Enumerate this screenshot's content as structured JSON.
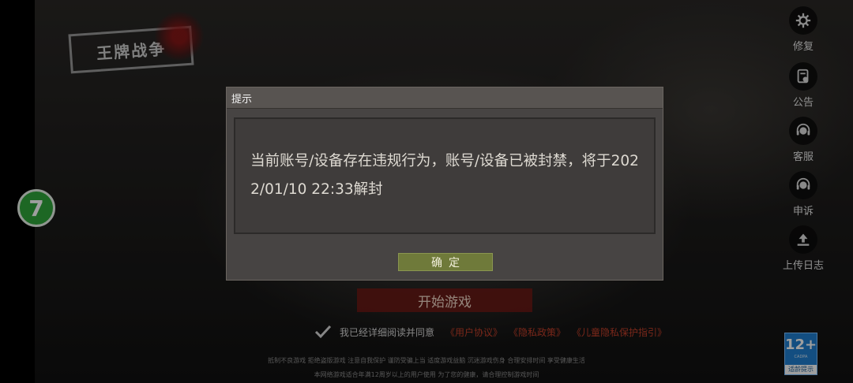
{
  "game": {
    "logo_text": "王牌战争"
  },
  "floating_button": {
    "label": "7"
  },
  "side_menu": {
    "items": [
      {
        "label": "修复",
        "icon": "gear-icon"
      },
      {
        "label": "公告",
        "icon": "announcement-icon"
      },
      {
        "label": "客服",
        "icon": "headset-icon"
      },
      {
        "label": "申诉",
        "icon": "headset-icon"
      },
      {
        "label": "上传日志",
        "icon": "upload-icon"
      }
    ]
  },
  "main": {
    "start_button_label": "开始游戏",
    "agreement": {
      "text": "我已经详细阅读并同意",
      "links": [
        "《用户协议》",
        "《隐私政策》",
        "《儿童隐私保护指引》"
      ]
    },
    "health_notice_line1": "抵制不良游戏 拒绝盗版游戏 注意自我保护 谨防受骗上当 适度游戏益脑 沉迷游戏伤身 合理安排时间 享受健康生活",
    "health_notice_line2": "本网络游戏适合年满12周岁以上的用户使用   为了您的健康，请合理控制游戏时间",
    "age_rating": {
      "number": "12+",
      "sub": "CADPA",
      "caption": "适龄提示"
    }
  },
  "dialog": {
    "title": "提示",
    "message_line1": "当前账号/设备存在违规行为，账号/设备已被封禁，将于202",
    "message_line2": "2/01/10 22:33解封",
    "confirm_label": "确定"
  },
  "colors": {
    "start_button": "#781914",
    "confirm_button": "#6f7a3a",
    "link": "#c5402a",
    "float_button": "#2fa63a",
    "age_badge": "#1f7fd0"
  }
}
